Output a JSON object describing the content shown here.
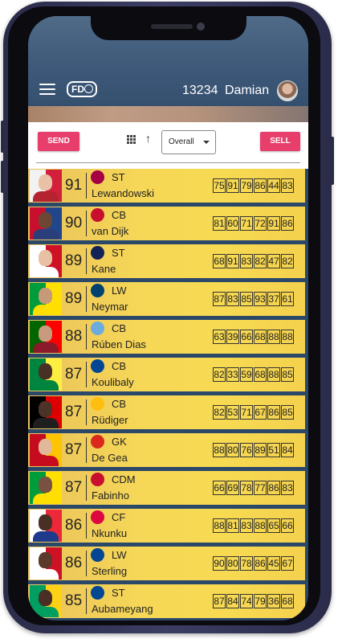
{
  "header": {
    "logo_text": "FD",
    "coins": "13234",
    "username": "Damian"
  },
  "toolbar": {
    "send_label": "SEND",
    "sell_label": "SELL",
    "sort_select": "Overall"
  },
  "players": [
    {
      "rating": "91",
      "position": "ST",
      "name": "Lewandowski",
      "club": "barcelona",
      "stats": [
        "75",
        "91",
        "79",
        "86",
        "44",
        "83"
      ],
      "skin": "#e9c1a6",
      "shirt": "#b32430",
      "bg": "#f2f2f2",
      "bg2": "#d21f3c",
      "crest": "#a50044"
    },
    {
      "rating": "90",
      "position": "CB",
      "name": "van Dijk",
      "club": "liverpool",
      "stats": [
        "81",
        "60",
        "71",
        "72",
        "91",
        "86"
      ],
      "skin": "#6b4734",
      "shirt": "#2a3f7a",
      "bg": "#c8102e",
      "bg2": "#21468b",
      "crest": "#c8102e"
    },
    {
      "rating": "89",
      "position": "ST",
      "name": "Kane",
      "club": "tottenham",
      "stats": [
        "68",
        "91",
        "83",
        "82",
        "47",
        "82"
      ],
      "skin": "#e8c1a5",
      "shirt": "#ffffff",
      "bg": "#ffffff",
      "bg2": "#ce1124",
      "crest": "#132257"
    },
    {
      "rating": "89",
      "position": "LW",
      "name": "Neymar",
      "club": "psg",
      "stats": [
        "87",
        "83",
        "85",
        "93",
        "37",
        "61"
      ],
      "skin": "#c69a78",
      "shirt": "#fedf00",
      "bg": "#009c3b",
      "bg2": "#fedf00",
      "crest": "#004170"
    },
    {
      "rating": "88",
      "position": "CB",
      "name": "Rúben Dias",
      "club": "man-city",
      "stats": [
        "63",
        "39",
        "66",
        "68",
        "88",
        "88"
      ],
      "skin": "#c89a7e",
      "shirt": "#8b1a2b",
      "bg": "#006600",
      "bg2": "#ff0000",
      "crest": "#6cabdd"
    },
    {
      "rating": "87",
      "position": "CB",
      "name": "Koulibaly",
      "club": "chelsea",
      "stats": [
        "82",
        "33",
        "59",
        "68",
        "88",
        "85"
      ],
      "skin": "#4a2f24",
      "shirt": "#00853f",
      "bg": "#00853f",
      "bg2": "#fdef42",
      "crest": "#034694"
    },
    {
      "rating": "87",
      "position": "CB",
      "name": "Rüdiger",
      "club": "real-madrid",
      "stats": [
        "82",
        "53",
        "71",
        "67",
        "86",
        "85"
      ],
      "skin": "#4c3227",
      "shirt": "#1f1f1f",
      "bg": "#000000",
      "bg2": "#dd0000",
      "crest": "#febe10"
    },
    {
      "rating": "87",
      "position": "GK",
      "name": "De Gea",
      "club": "man-united",
      "stats": [
        "88",
        "80",
        "76",
        "89",
        "51",
        "84"
      ],
      "skin": "#e2b89b",
      "shirt": "#c60b1e",
      "bg": "#c60b1e",
      "bg2": "#ffc400",
      "crest": "#da291c"
    },
    {
      "rating": "87",
      "position": "CDM",
      "name": "Fabinho",
      "club": "liverpool",
      "stats": [
        "66",
        "69",
        "78",
        "77",
        "86",
        "83"
      ],
      "skin": "#7a5140",
      "shirt": "#fedf00",
      "bg": "#009c3b",
      "bg2": "#fedf00",
      "crest": "#c8102e"
    },
    {
      "rating": "86",
      "position": "CF",
      "name": "Nkunku",
      "club": "leipzig",
      "stats": [
        "88",
        "81",
        "83",
        "88",
        "65",
        "66"
      ],
      "skin": "#4a2f24",
      "shirt": "#1e3a8a",
      "bg": "#ffffff",
      "bg2": "#ed2939",
      "crest": "#dd0741"
    },
    {
      "rating": "86",
      "position": "LW",
      "name": "Sterling",
      "club": "chelsea",
      "stats": [
        "90",
        "80",
        "78",
        "86",
        "45",
        "67"
      ],
      "skin": "#5b3a2c",
      "shirt": "#ffffff",
      "bg": "#ffffff",
      "bg2": "#ce1124",
      "crest": "#034694"
    },
    {
      "rating": "85",
      "position": "ST",
      "name": "Aubameyang",
      "club": "chelsea",
      "stats": [
        "87",
        "84",
        "74",
        "79",
        "36",
        "68"
      ],
      "skin": "#4a2f24",
      "shirt": "#009e60",
      "bg": "#009e60",
      "bg2": "#fcd116",
      "crest": "#034694"
    }
  ]
}
